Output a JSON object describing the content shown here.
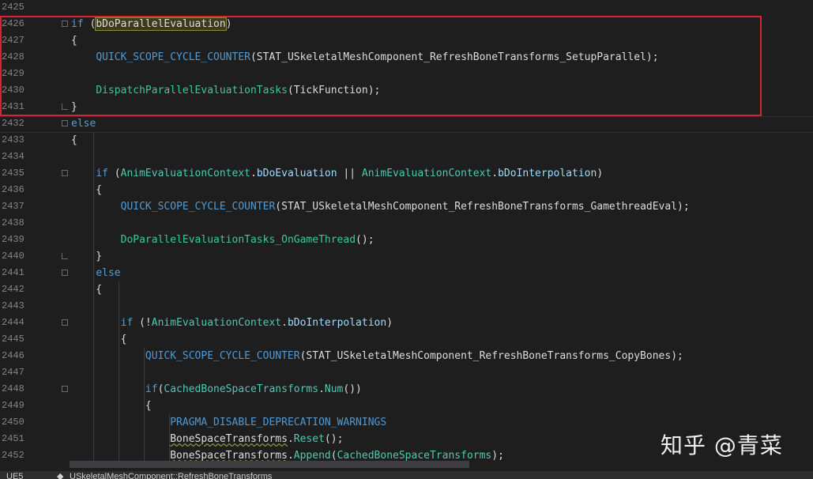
{
  "lines": [
    {
      "n": "2425",
      "t": []
    },
    {
      "n": "2426",
      "t": [
        [
          "kw",
          "if "
        ],
        [
          "id",
          "("
        ],
        [
          "hl",
          "bDoParallelEvaluation"
        ],
        [
          "id",
          ")"
        ]
      ]
    },
    {
      "n": "2427",
      "t": [
        [
          "id",
          "{"
        ]
      ]
    },
    {
      "n": "2428",
      "t": [
        [
          "id",
          "    "
        ],
        [
          "mac",
          "QUICK_SCOPE_CYCLE_COUNTER"
        ],
        [
          "id",
          "(STAT_USkeletalMeshComponent_RefreshBoneTransforms_SetupParallel);"
        ]
      ]
    },
    {
      "n": "2429",
      "t": []
    },
    {
      "n": "2430",
      "t": [
        [
          "id",
          "    "
        ],
        [
          "fnc",
          "DispatchParallelEvaluationTasks"
        ],
        [
          "id",
          "(TickFunction);"
        ]
      ]
    },
    {
      "n": "2431",
      "t": [
        [
          "id",
          "}"
        ]
      ]
    },
    {
      "n": "2432",
      "t": [
        [
          "kw",
          "else"
        ]
      ]
    },
    {
      "n": "2433",
      "t": [
        [
          "id",
          "{"
        ]
      ]
    },
    {
      "n": "2434",
      "t": []
    },
    {
      "n": "2435",
      "t": [
        [
          "id",
          "    "
        ],
        [
          "kw",
          "if "
        ],
        [
          "id",
          "("
        ],
        [
          "cls",
          "AnimEvaluationContext"
        ],
        [
          "id",
          "."
        ],
        [
          "prop",
          "bDoEvaluation"
        ],
        [
          "id",
          " || "
        ],
        [
          "cls",
          "AnimEvaluationContext"
        ],
        [
          "id",
          "."
        ],
        [
          "prop",
          "bDoInterpolation"
        ],
        [
          "id",
          ")"
        ]
      ]
    },
    {
      "n": "2436",
      "t": [
        [
          "id",
          "    {"
        ]
      ]
    },
    {
      "n": "2437",
      "t": [
        [
          "id",
          "        "
        ],
        [
          "mac",
          "QUICK_SCOPE_CYCLE_COUNTER"
        ],
        [
          "id",
          "(STAT_USkeletalMeshComponent_RefreshBoneTransforms_GamethreadEval);"
        ]
      ]
    },
    {
      "n": "2438",
      "t": []
    },
    {
      "n": "2439",
      "t": [
        [
          "id",
          "        "
        ],
        [
          "fnc",
          "DoParallelEvaluationTasks_OnGameThread"
        ],
        [
          "id",
          "();"
        ]
      ]
    },
    {
      "n": "2440",
      "t": [
        [
          "id",
          "    }"
        ]
      ]
    },
    {
      "n": "2441",
      "t": [
        [
          "id",
          "    "
        ],
        [
          "kw",
          "else"
        ]
      ]
    },
    {
      "n": "2442",
      "t": [
        [
          "id",
          "    {"
        ]
      ]
    },
    {
      "n": "2443",
      "t": []
    },
    {
      "n": "2444",
      "t": [
        [
          "id",
          "        "
        ],
        [
          "kw",
          "if "
        ],
        [
          "id",
          "(!"
        ],
        [
          "cls",
          "AnimEvaluationContext"
        ],
        [
          "id",
          "."
        ],
        [
          "prop",
          "bDoInterpolation"
        ],
        [
          "id",
          ")"
        ]
      ]
    },
    {
      "n": "2445",
      "t": [
        [
          "id",
          "        {"
        ]
      ]
    },
    {
      "n": "2446",
      "t": [
        [
          "id",
          "            "
        ],
        [
          "mac",
          "QUICK_SCOPE_CYCLE_COUNTER"
        ],
        [
          "id",
          "(STAT_USkeletalMeshComponent_RefreshBoneTransforms_CopyBones);"
        ]
      ]
    },
    {
      "n": "2447",
      "t": []
    },
    {
      "n": "2448",
      "t": [
        [
          "id",
          "            "
        ],
        [
          "kw",
          "if"
        ],
        [
          "id",
          "("
        ],
        [
          "cls",
          "CachedBoneSpaceTransforms"
        ],
        [
          "id",
          "."
        ],
        [
          "fn",
          "Num"
        ],
        [
          "id",
          "())"
        ]
      ]
    },
    {
      "n": "2449",
      "t": [
        [
          "id",
          "            {"
        ]
      ]
    },
    {
      "n": "2450",
      "t": [
        [
          "id",
          "                "
        ],
        [
          "mac",
          "PRAGMA_DISABLE_DEPRECATION_WARNINGS"
        ]
      ]
    },
    {
      "n": "2451",
      "t": [
        [
          "id",
          "                "
        ],
        [
          "wavy",
          "BoneSpaceTransforms"
        ],
        [
          "id",
          "."
        ],
        [
          "fn",
          "Reset"
        ],
        [
          "id",
          "();"
        ]
      ]
    },
    {
      "n": "2452",
      "t": [
        [
          "id",
          "                "
        ],
        [
          "wavy",
          "BoneSpaceTransforms"
        ],
        [
          "id",
          "."
        ],
        [
          "fn",
          "Append"
        ],
        [
          "id",
          "("
        ],
        [
          "cls",
          "CachedBoneSpaceTransforms"
        ],
        [
          "id",
          ");"
        ]
      ]
    }
  ],
  "folds": {
    "2426": "open",
    "2431": "end",
    "2432": "open",
    "2435": "open",
    "2440": "end",
    "2441": "open",
    "2444": "open",
    "2448": "open"
  },
  "statusbar": {
    "project": "UE5",
    "scope": "USkeletalMeshComponent::RefreshBoneTransforms"
  },
  "watermark": "知乎 @青菜",
  "colors": {
    "highlight_box": "#d8242f",
    "background": "#1e1e1e"
  }
}
